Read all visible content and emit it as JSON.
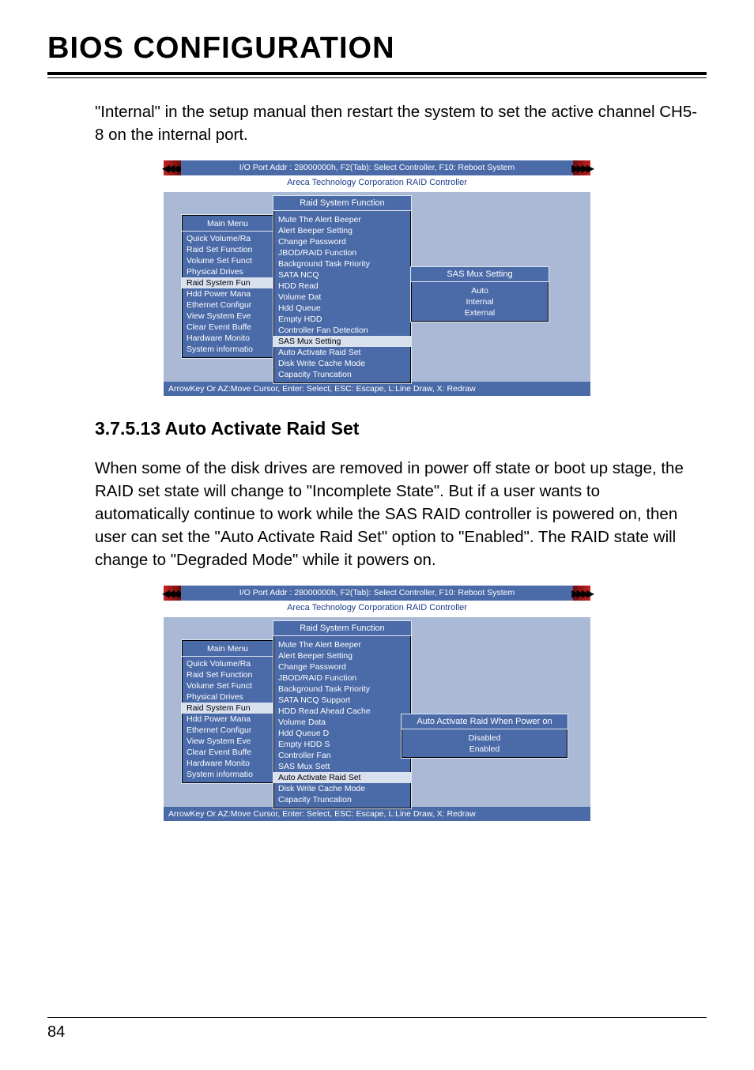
{
  "page": {
    "title": "BIOS CONFIGURATION",
    "intro_text": "\"Internal\" in the setup manual then restart the system to set the active channel CH5-8 on the internal port.",
    "section_number_title": "3.7.5.13 Auto Activate Raid Set",
    "section_body": "When some of the disk drives are removed in power off state or boot up stage, the RAID set state will change to \"Incomplete State\". But if a user wants to automatically continue to work while the SAS RAID controller is powered on, then user can set the \"Auto Activate Raid Set\" option to \"Enabled\". The RAID state will change to \"Degraded Mode\" while it powers on.",
    "page_number": "84"
  },
  "bios_common": {
    "header": "I/O Port Addr : 28000000h, F2(Tab): Select Controller, F10: Reboot System",
    "subheader": "Areca Technology Corporation RAID Controller",
    "footer": "ArrowKey Or AZ:Move Cursor, Enter: Select, ESC: Escape, L:Line Draw, X: Redraw",
    "main_menu_title": "Main Menu",
    "main_menu_items": [
      "Quick Volume/Ra",
      "Raid Set Function",
      "Volume Set Funct",
      "Physical Drives",
      "Raid System Fun",
      "Hdd Power Mana",
      "Ethernet Configur",
      "View System Eve",
      "Clear Event Buffe",
      "Hardware Monito",
      "System informatio"
    ],
    "raid_func_title": "Raid System Function"
  },
  "bios1": {
    "raid_func_items_top": [
      "Mute The Alert Beeper",
      "Alert Beeper Setting",
      "Change Password",
      "JBOD/RAID Function",
      "Background Task Priority",
      "SATA NCQ",
      "HDD Read",
      "Volume Dat",
      "Hdd Queue",
      "Empty HDD",
      "Controller Fan Detection"
    ],
    "raid_func_highlight": "SAS Mux Setting",
    "raid_func_items_bottom": [
      "Auto Activate Raid Set",
      "Disk Write Cache Mode",
      "Capacity Truncation"
    ],
    "popup_title": "SAS Mux Setting",
    "popup_options": [
      "Auto",
      "Internal",
      "External"
    ]
  },
  "bios2": {
    "raid_func_items_top": [
      "Mute The Alert Beeper",
      "Alert Beeper Setting",
      "Change Password",
      "JBOD/RAID Function",
      "Background Task Priority",
      "SATA NCQ Support",
      "HDD Read Ahead Cache",
      "Volume Data",
      "Hdd Queue D",
      "Empty HDD S",
      "Controller Fan",
      "SAS Mux Sett"
    ],
    "raid_func_highlight": "Auto Activate Raid Set",
    "raid_func_items_bottom": [
      "Disk Write Cache Mode",
      "Capacity Truncation"
    ],
    "popup_title": "Auto Activate Raid When Power on",
    "popup_options": [
      "Disabled",
      "Enabled"
    ]
  }
}
